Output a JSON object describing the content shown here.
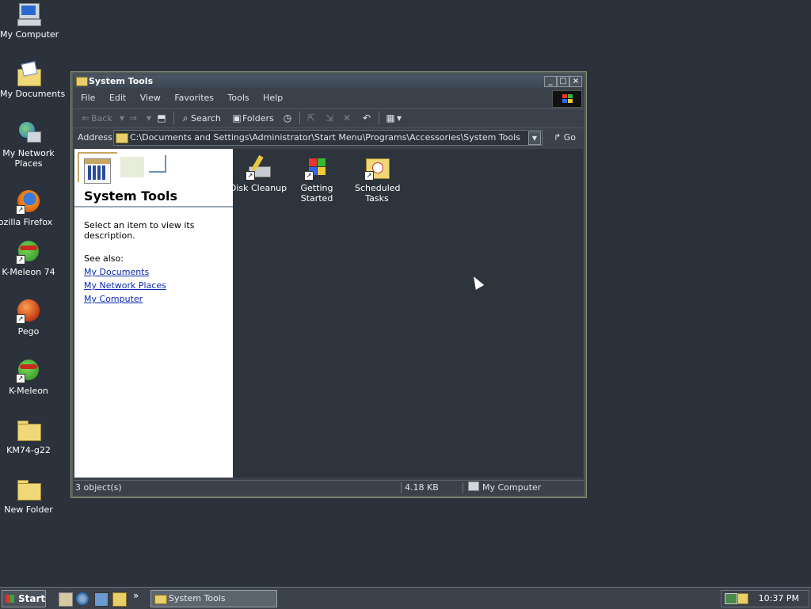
{
  "desktop": {
    "icons": [
      {
        "label": "My Computer"
      },
      {
        "label": "My Documents"
      },
      {
        "label": "My Network Places"
      },
      {
        "label": "ozilla Firefox"
      },
      {
        "label": "K-Meleon 74"
      },
      {
        "label": "Pego"
      },
      {
        "label": "K-Meleon"
      },
      {
        "label": "KM74-g22"
      },
      {
        "label": "New Folder"
      }
    ]
  },
  "window": {
    "title": "System Tools",
    "menu": [
      "File",
      "Edit",
      "View",
      "Favorites",
      "Tools",
      "Help"
    ],
    "toolbar": {
      "back": "Back",
      "search": "Search",
      "folders": "Folders"
    },
    "address": {
      "label": "Address",
      "value": "C:\\Documents and Settings\\Administrator\\Start Menu\\Programs\\Accessories\\System Tools",
      "go": "Go"
    },
    "left_pane": {
      "title": "System Tools",
      "description": "Select an item to view its description.",
      "see_also": "See also:",
      "links": [
        "My Documents",
        "My Network Places",
        "My Computer"
      ]
    },
    "items": [
      {
        "label": "Disk Cleanup"
      },
      {
        "label": "Getting Started"
      },
      {
        "label": "Scheduled Tasks"
      }
    ],
    "status": {
      "objects": "3 object(s)",
      "size": "4.18 KB",
      "zone": "My Computer"
    }
  },
  "taskbar": {
    "start": "Start",
    "more": "»",
    "task": "System Tools",
    "clock": "10:37 PM"
  }
}
